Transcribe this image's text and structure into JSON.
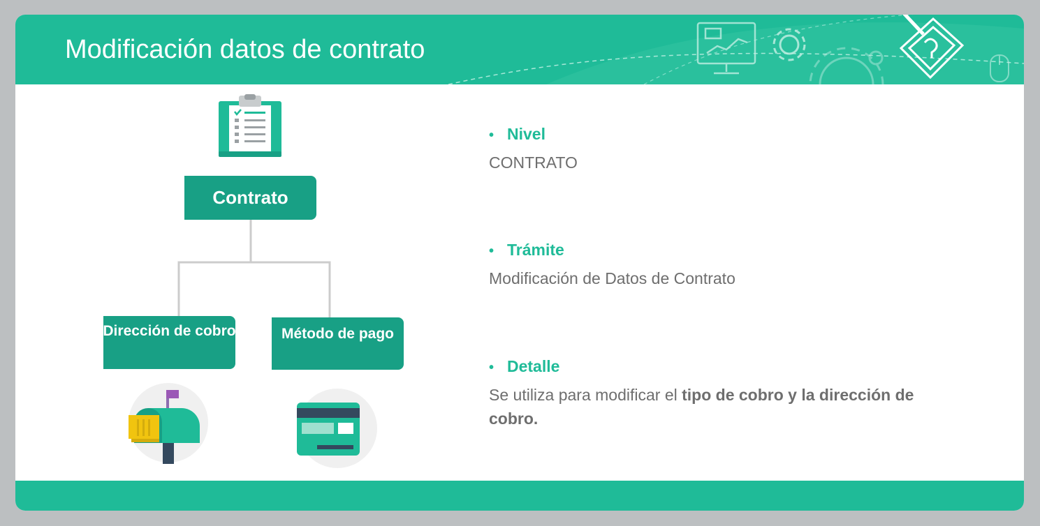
{
  "header": {
    "title": "Modificación datos de contrato"
  },
  "diagram": {
    "root": "Contrato",
    "children": [
      "Dirección de cobro",
      "Método de pago"
    ]
  },
  "details": [
    {
      "heading": "Nivel",
      "text": "CONTRATO"
    },
    {
      "heading": "Trámite",
      "text": "Modificación de Datos de Contrato"
    },
    {
      "heading": "Detalle",
      "text_before": "Se utiliza para modificar el ",
      "text_bold": "tipo de cobro y la dirección de cobro."
    }
  ],
  "colors": {
    "accent": "#1fbb98",
    "box": "#18a085",
    "text_gray": "#6e6e6e",
    "background": "#bcbfc1"
  },
  "icons": [
    "clipboard-icon",
    "mailbox-icon",
    "credit-card-icon",
    "monitor-chart-icon",
    "gear-icon",
    "pencil-help-icon",
    "mouse-icon"
  ]
}
